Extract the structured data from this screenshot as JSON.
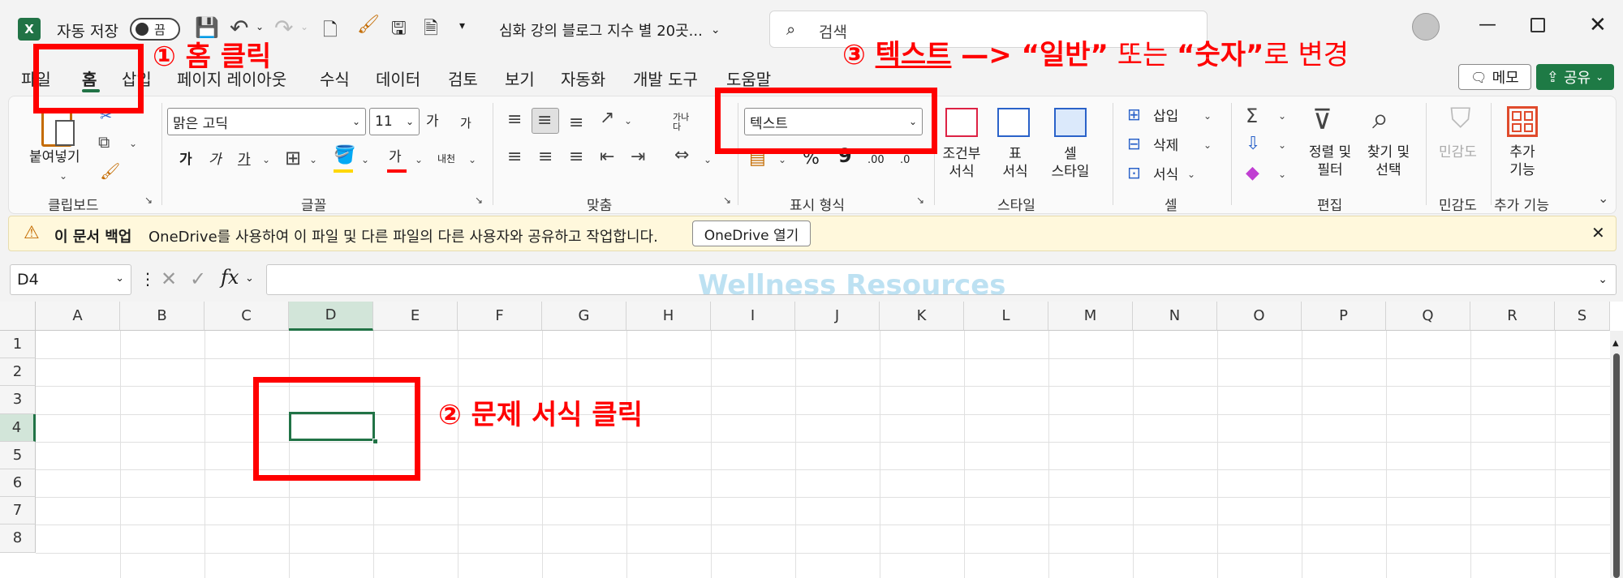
{
  "titlebar": {
    "autosave_label": "자동 저장",
    "autosave_state": "끔",
    "doc_title": "심화 강의 블로그 지수 별 20곳...",
    "search_placeholder": "검색"
  },
  "tabs": [
    "파일",
    "홈",
    "삽입",
    "페이지 레이아웃",
    "수식",
    "데이터",
    "검토",
    "보기",
    "자동화",
    "개발 도구",
    "도움말"
  ],
  "header_buttons": {
    "memo": "메모",
    "share": "공유"
  },
  "ribbon": {
    "clipboard": {
      "paste": "붙여넣기",
      "label": "클립보드"
    },
    "font": {
      "name": "맑은 고딕",
      "size": "11",
      "grow": "가",
      "shrink": "가",
      "bold": "가",
      "italic": "가",
      "underline": "가",
      "color_a": "가",
      "phonetic": "내천",
      "label": "글꼴"
    },
    "align": {
      "wrap": "가나다",
      "label": "맞춤"
    },
    "number": {
      "format": "텍스트",
      "percent": "%",
      "comma": "9",
      "inc": ".00",
      "dec": ".0",
      "label": "표시 형식"
    },
    "styles": {
      "cond1": "조건부",
      "cond2": "서식",
      "table1": "표",
      "table2": "서식",
      "cell1": "셀",
      "cell2": "스타일",
      "label": "스타일"
    },
    "cells": {
      "insert": "삽입",
      "delete": "삭제",
      "format": "서식",
      "label": "셀"
    },
    "editing": {
      "sort1": "정렬 및",
      "sort2": "필터",
      "find1": "찾기 및",
      "find2": "선택",
      "label": "편집"
    },
    "sensitivity": {
      "name": "민감도",
      "label": "민감도"
    },
    "addins": {
      "name1": "추가",
      "name2": "기능",
      "label": "추가 기능"
    }
  },
  "notice": {
    "title": "이 문서 백업",
    "message": "OneDrive를 사용하여 이 파일 및 다른 파일의 다른 사용자와 공유하고 작업합니다.",
    "button": "OneDrive 열기"
  },
  "formula": {
    "namebox": "D4",
    "fx": "fx",
    "value": ""
  },
  "watermark": "Wellness Resources",
  "columns": [
    "A",
    "B",
    "C",
    "D",
    "E",
    "F",
    "G",
    "H",
    "I",
    "J",
    "K",
    "L",
    "M",
    "N",
    "O",
    "P",
    "Q",
    "R",
    "S"
  ],
  "rows": [
    "1",
    "2",
    "3",
    "4",
    "5",
    "6",
    "7",
    "8"
  ],
  "annotations": {
    "step1": "① 홈 클릭",
    "step2": "② 문제 서식 클릭",
    "step3_prefix": "③ ",
    "step3_text": "텍스트",
    "step3_arrow": " —> ",
    "step3_general": "“일반”",
    "step3_or": " 또는 ",
    "step3_number": "“숫자”",
    "step3_suffix": "로 변경"
  },
  "colors": {
    "excel_green": "#217346",
    "annotation_red": "#ff0000",
    "share_green": "#1e7a45"
  }
}
